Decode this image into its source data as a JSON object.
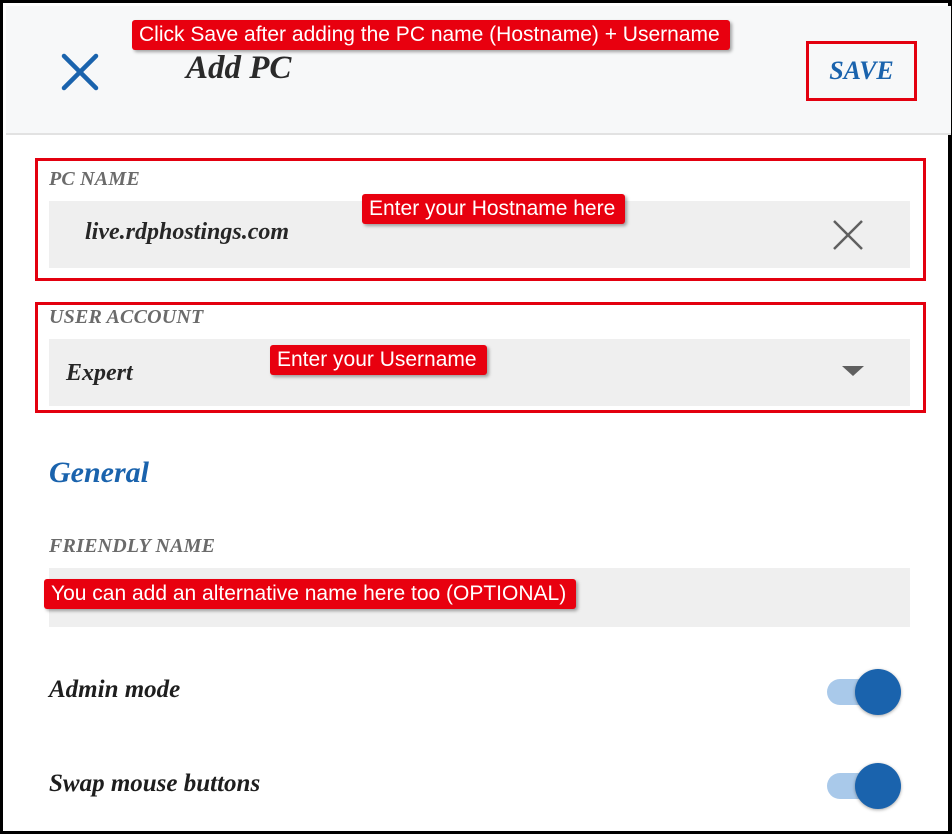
{
  "header": {
    "close_icon": "close-icon",
    "title": "Add PC",
    "save_label": "SAVE"
  },
  "annotations": {
    "save_hint": "Click Save after adding the PC name (Hostname) + Username",
    "hostname_hint": "Enter your Hostname here",
    "username_hint": "Enter your Username",
    "friendly_hint": "You can add an alternative name here too (OPTIONAL)",
    "highlight_color": "#e8000f"
  },
  "pc_name": {
    "label": "PC NAME",
    "value": "live.rdphostings.com",
    "clear_icon": "clear-icon"
  },
  "user_account": {
    "label": "USER ACCOUNT",
    "selected": "Expert",
    "dropdown_icon": "caret-down-icon"
  },
  "general": {
    "title": "General",
    "friendly_name": {
      "label": "FRIENDLY NAME",
      "value": ""
    },
    "toggles": [
      {
        "label": "Admin mode",
        "on": true
      },
      {
        "label": "Swap mouse buttons",
        "on": true
      }
    ]
  },
  "colors": {
    "accent": "#1a63ad",
    "toggle_track": "#a9c9ea",
    "field_bg": "#efefef"
  }
}
